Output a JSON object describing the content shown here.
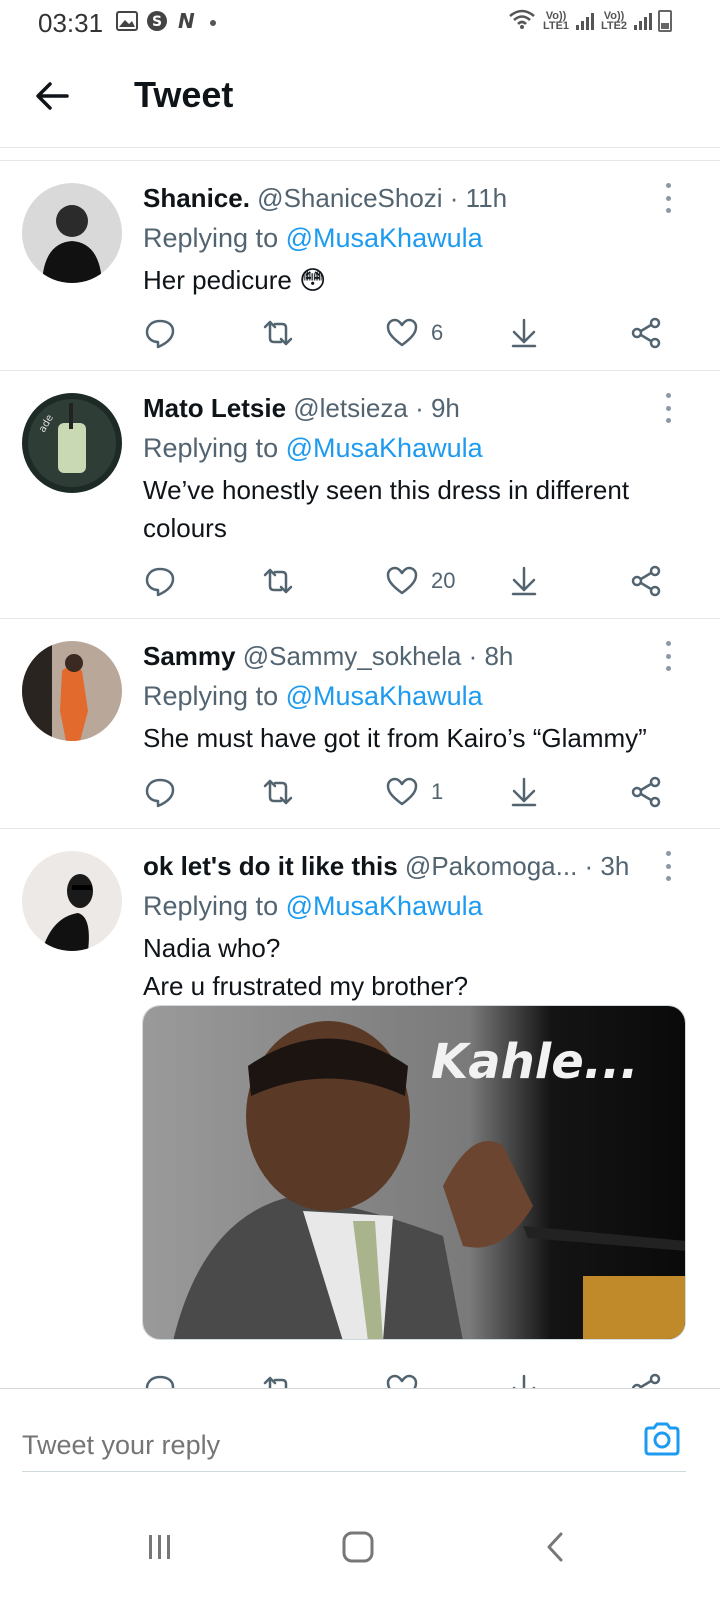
{
  "status_bar": {
    "time": "03:31",
    "lte1": "Vo)) LTE1",
    "lte2": "Vo)) LTE2"
  },
  "header": {
    "title": "Tweet"
  },
  "tweets": [
    {
      "name": "Shanice.",
      "handle": "@ShaniceShozi",
      "time": "· 11h",
      "replying_prefix": "Replying to",
      "replying_to": "@MusaKhawula",
      "text": "Her pedicure 😳",
      "likes": "6"
    },
    {
      "name": "Mato Letsie",
      "handle": "@letsieza",
      "time": "· 9h",
      "replying_prefix": "Replying to",
      "replying_to": "@MusaKhawula",
      "text": "We’ve honestly seen this dress in different colours",
      "likes": "20"
    },
    {
      "name": "Sammy",
      "handle": "@Sammy_sokhela",
      "time": "· 8h",
      "replying_prefix": "Replying to",
      "replying_to": "@MusaKhawula",
      "text": "She must have got it from Kairo’s “Glammy”",
      "likes": "1"
    },
    {
      "name": "ok let's do it like this",
      "handle": "@Pakomoga...",
      "time": "· 3h",
      "replying_prefix": "Replying to",
      "replying_to": "@MusaKhawula",
      "text_line1": "Nadia who?",
      "text_line2": "Are u frustrated my brother?",
      "media_caption": "Kahle..."
    }
  ],
  "reply_bar": {
    "placeholder": "Tweet your reply"
  },
  "colors": {
    "accent": "#1d9bf0",
    "secondary_text": "#536471",
    "primary_text": "#0f1419",
    "divider": "#e6e6e6"
  }
}
